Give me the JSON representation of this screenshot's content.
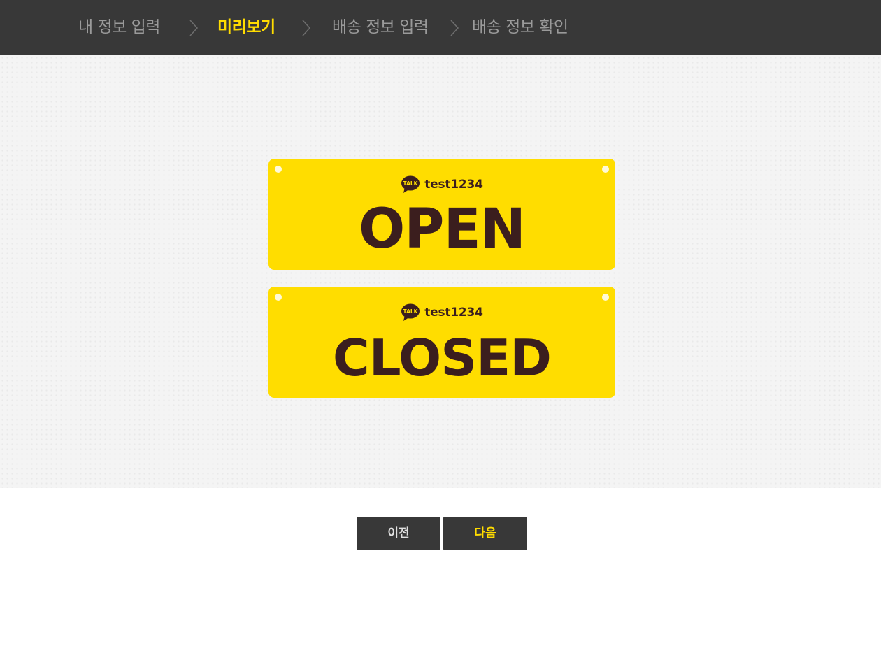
{
  "steps": [
    {
      "label": "내 정보 입력",
      "active": false
    },
    {
      "label": "미리보기",
      "active": true
    },
    {
      "label": "배송 정보 입력",
      "active": false
    },
    {
      "label": "배송 정보 확인",
      "active": false
    }
  ],
  "preview": {
    "signs": [
      {
        "icon": "kakaotalk-talk-icon",
        "icon_text": "TALK",
        "user_id": "test1234",
        "word": "OPEN"
      },
      {
        "icon": "kakaotalk-talk-icon",
        "icon_text": "TALK",
        "user_id": "test1234",
        "word": "CLOSED"
      }
    ]
  },
  "buttons": {
    "prev_label": "이전",
    "next_label": "다음"
  },
  "colors": {
    "header_bg": "#383838",
    "active_step": "#ffdc00",
    "inactive_step": "#9a9a9a",
    "sign_yellow": "#ffdd00",
    "sign_text": "#3b1e1e"
  }
}
